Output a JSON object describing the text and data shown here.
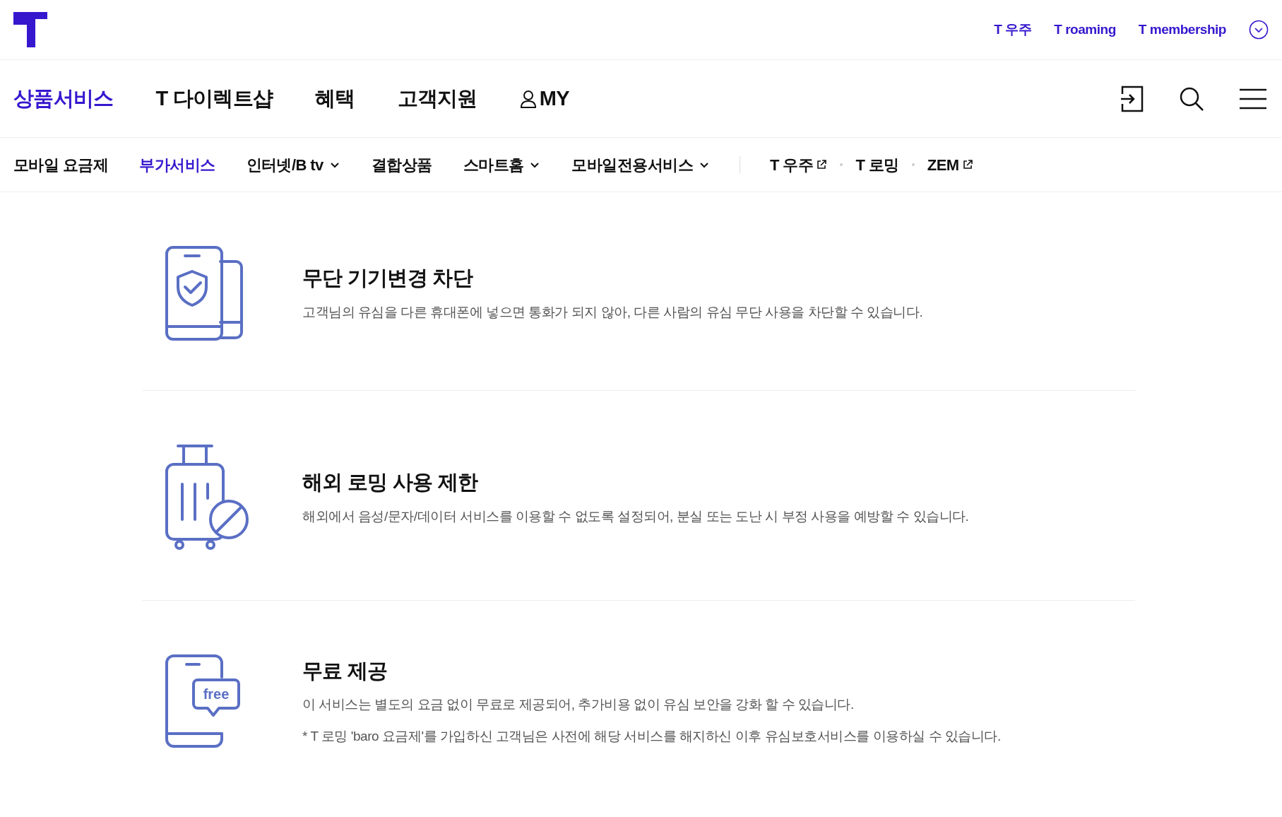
{
  "header": {
    "top_links": [
      {
        "label": "T 우주"
      },
      {
        "label": "T roaming"
      },
      {
        "label": "T membership"
      }
    ]
  },
  "main_nav": [
    {
      "label": "상품서비스",
      "selected": true
    },
    {
      "label": "T 다이렉트샵",
      "selected": false
    },
    {
      "label": "혜택",
      "selected": false
    },
    {
      "label": "고객지원",
      "selected": false
    },
    {
      "label": "MY",
      "selected": false,
      "kind": "user"
    }
  ],
  "sub_nav": [
    {
      "label": "모바일 요금제",
      "selected": false,
      "kind": "plain"
    },
    {
      "label": "부가서비스",
      "selected": true,
      "kind": "plain"
    },
    {
      "label": "인터넷/B tv",
      "selected": false,
      "kind": "dropdown"
    },
    {
      "label": "결합상품",
      "selected": false,
      "kind": "plain"
    },
    {
      "label": "스마트홈",
      "selected": false,
      "kind": "dropdown"
    },
    {
      "label": "모바일전용서비스",
      "selected": false,
      "kind": "dropdown"
    }
  ],
  "sub_nav_links": [
    {
      "label": "T 우주",
      "kind": "external"
    },
    {
      "label": "T 로밍",
      "kind": "plain"
    },
    {
      "label": "ZEM",
      "kind": "external"
    }
  ],
  "features": [
    {
      "kind": "phones",
      "title": "무단 기기변경 차단",
      "description": "고객님의 유심을 다른 휴대폰에 넣으면 통화가 되지 않아, 다른 사람의 유심 무단 사용을 차단할 수 있습니다."
    },
    {
      "kind": "luggage",
      "title": "해외 로밍 사용 제한",
      "description": "해외에서 음성/문자/데이터 서비스를 이용할 수 없도록 설정되어, 분실 또는 도난 시 부정 사용을 예방할 수 있습니다."
    },
    {
      "kind": "free",
      "icon_label": "free",
      "title": "무료 제공",
      "description": "이 서비스는 별도의 요금 없이 무료로 제공되어, 추가비용 없이 유심 보안을 강화 할 수 있습니다.",
      "note": "* T 로밍 'baro 요금제'를 가입하신 고객님은 사전에 해당 서비스를 해지하신 이후 유심보호서비스를 이용하실 수 있습니다."
    }
  ]
}
